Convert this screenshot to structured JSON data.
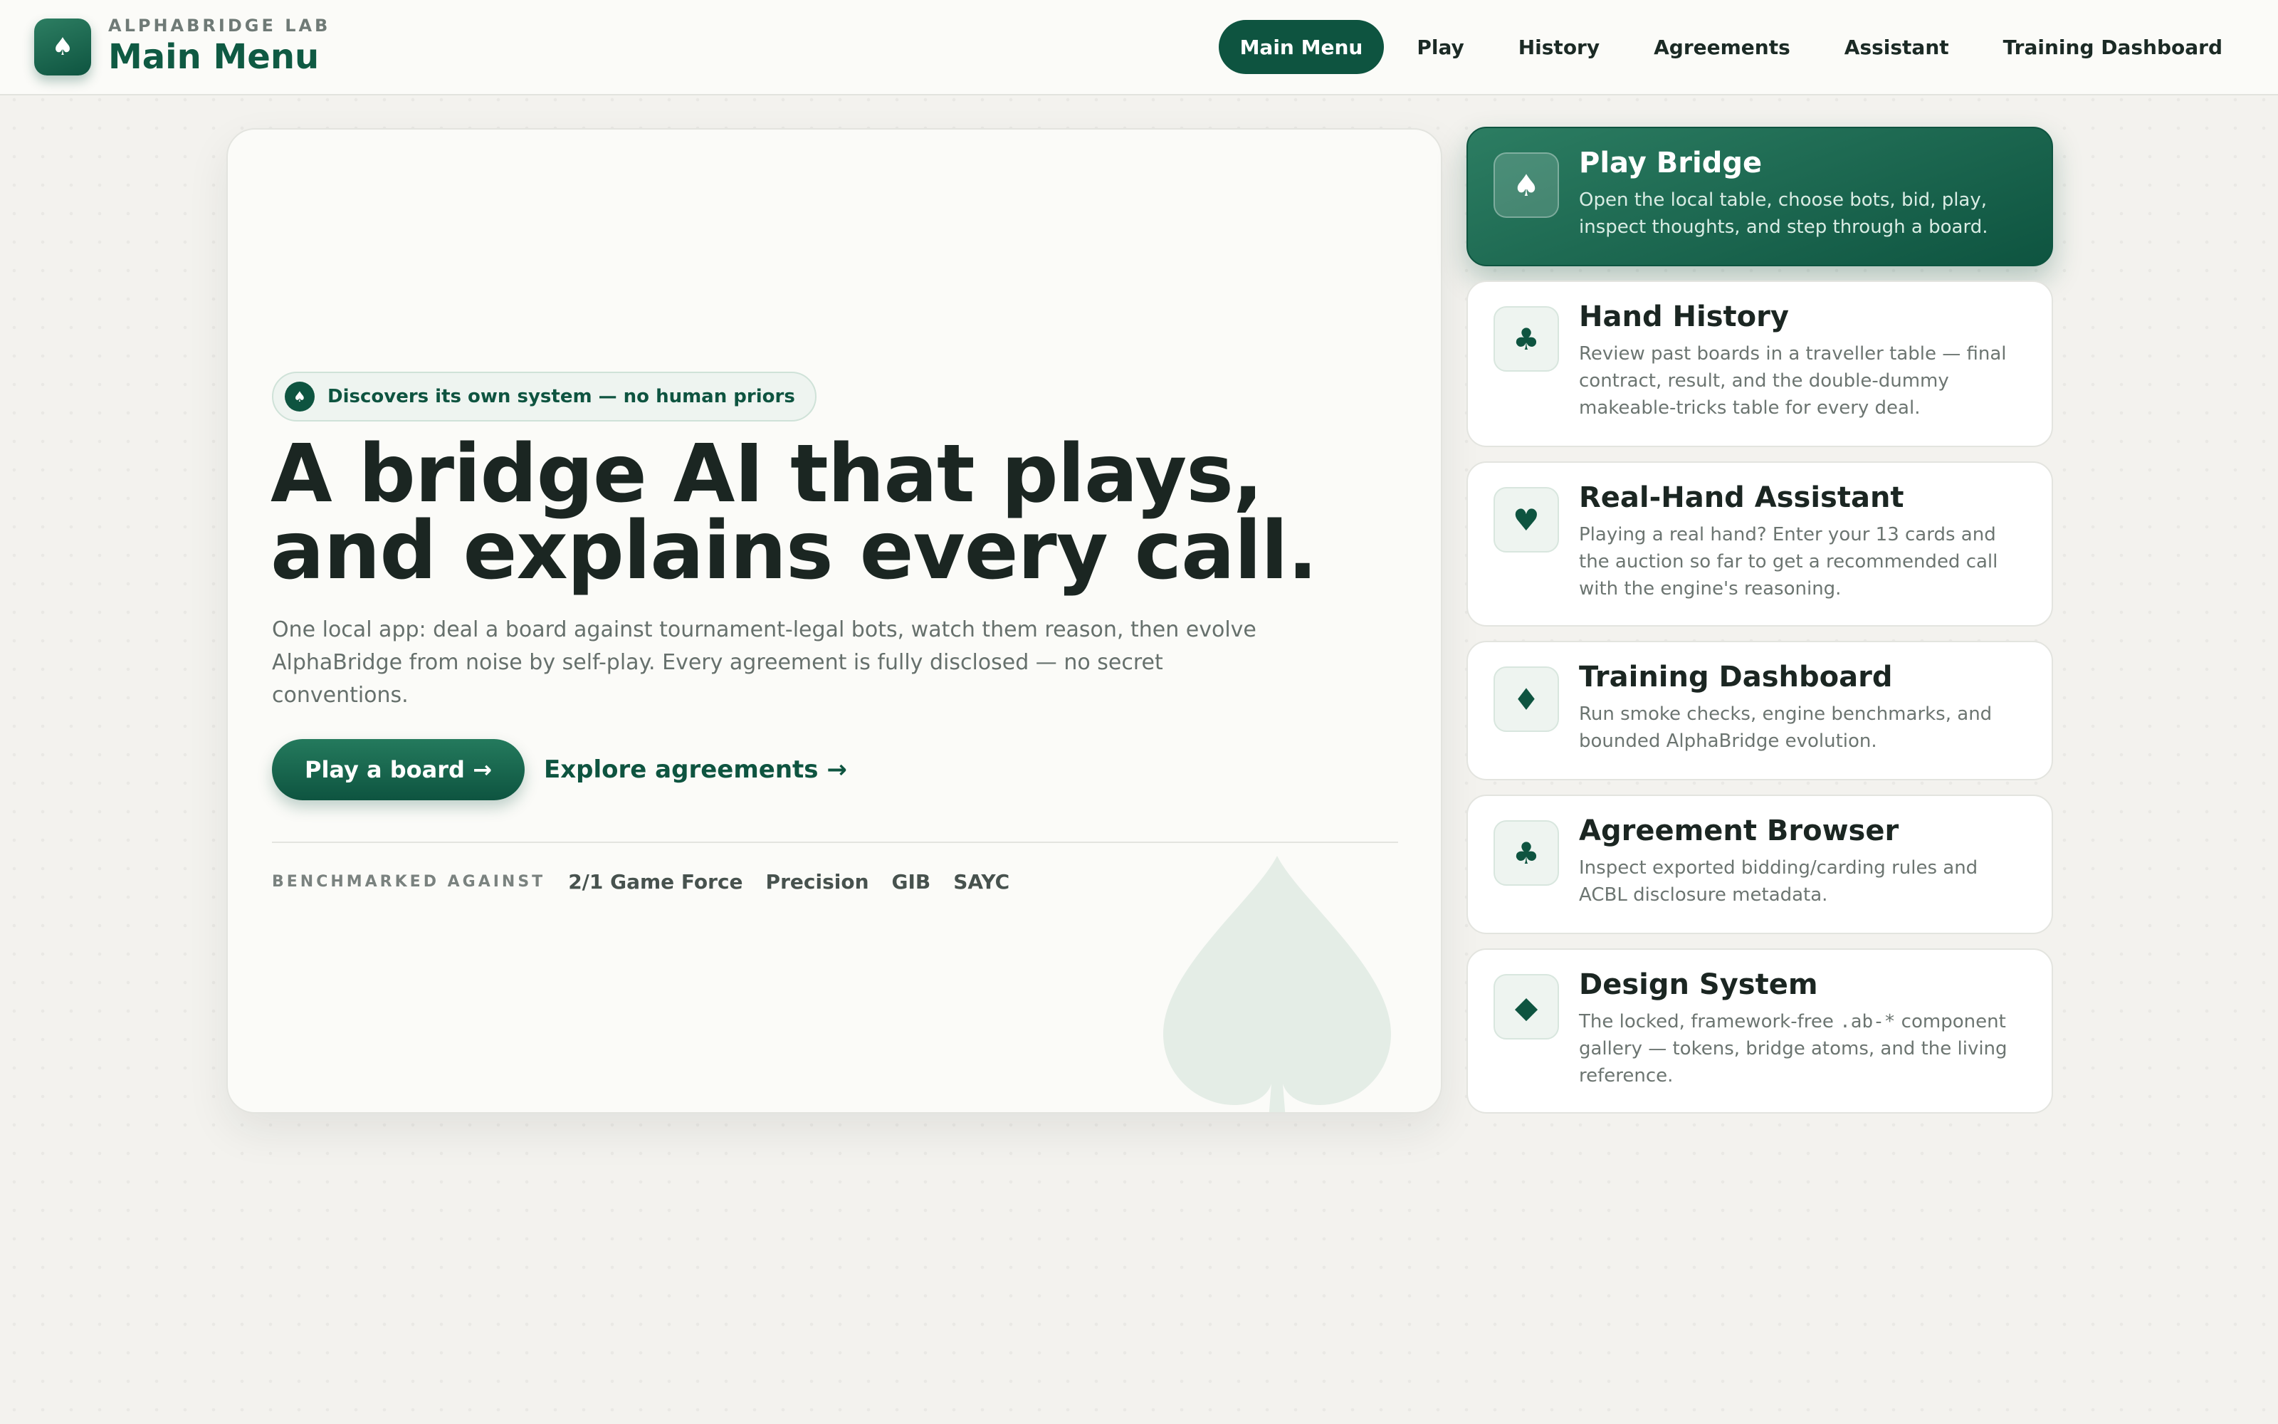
{
  "header": {
    "eyebrow": "ALPHABRIDGE LAB",
    "title": "Main Menu",
    "nav": [
      {
        "label": "Main Menu",
        "active": true
      },
      {
        "label": "Play",
        "active": false
      },
      {
        "label": "History",
        "active": false
      },
      {
        "label": "Agreements",
        "active": false
      },
      {
        "label": "Assistant",
        "active": false
      },
      {
        "label": "Training Dashboard",
        "active": false
      }
    ]
  },
  "hero": {
    "badge": "Discovers its own system — no human priors",
    "headline": "A bridge AI that plays, and explains every call.",
    "lede": "One local app: deal a board against tournament-legal bots, watch them reason, then evolve AlphaBridge from noise by self-play. Every agreement is fully disclosed — no secret conventions.",
    "primary_cta": "Play a board →",
    "secondary_cta": "Explore agreements →",
    "benchmark_label": "BENCHMARKED AGAINST",
    "benchmarks": [
      "2/1 Game Force",
      "Precision",
      "GIB",
      "SAYC"
    ]
  },
  "cards": [
    {
      "icon": "spade-icon",
      "glyph": "♠",
      "title": "Play Bridge",
      "description": "Open the local table, choose bots, bid, play, inspect thoughts, and step through a board."
    },
    {
      "icon": "club-icon",
      "glyph": "♣",
      "title": "Hand History",
      "description": "Review past boards in a traveller table — final contract, result, and the double-dummy makeable-tricks table for every deal."
    },
    {
      "icon": "heart-icon",
      "glyph": "♥",
      "title": "Real-Hand Assistant",
      "description": "Playing a real hand? Enter your 13 cards and the auction so far to get a recommended call with the engine's reasoning."
    },
    {
      "icon": "diamond-icon",
      "glyph": "♦",
      "title": "Training Dashboard",
      "description": "Run smoke checks, engine benchmarks, and bounded AlphaBridge evolution."
    },
    {
      "icon": "club-icon",
      "glyph": "♣",
      "title": "Agreement Browser",
      "description": "Inspect exported bidding/carding rules and ACBL disclosure metadata."
    },
    {
      "icon": "diamond-icon",
      "glyph": "◆",
      "title": "Design System",
      "description_pre": "The locked, framework-free ",
      "description_code": ".ab-*",
      "description_post": " component gallery — tokens, bridge atoms, and the living reference."
    }
  ],
  "colors": {
    "accent": "#0e5440",
    "background": "#f3f2ee",
    "text": "#1b2622"
  }
}
